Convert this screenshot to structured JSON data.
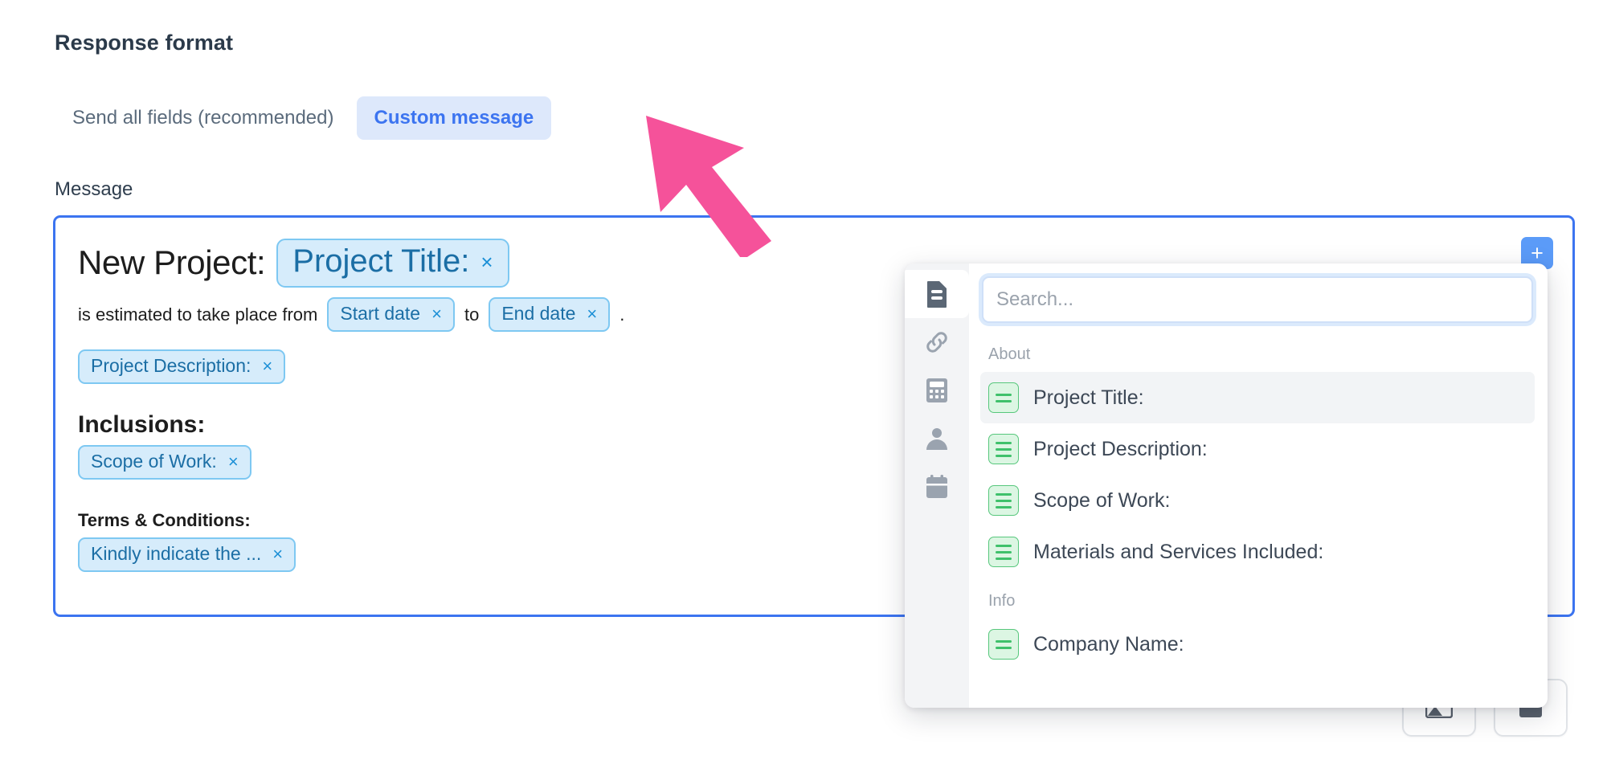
{
  "section": {
    "title": "Response format"
  },
  "format_toggle": {
    "options": [
      {
        "label": "Send all fields (recommended)",
        "active": false
      },
      {
        "label": "Custom message",
        "active": true
      }
    ]
  },
  "message_field": {
    "label": "Message",
    "content": {
      "heading_prefix": "New Project:",
      "heading_chip": "Project Title:",
      "line2_prefix": "is estimated to take place from",
      "line2_chip_start": "Start date",
      "line2_mid": "to",
      "line2_chip_end": "End date",
      "line2_suffix": ".",
      "desc_chip": "Project Description:",
      "inclusions_heading": "Inclusions:",
      "inclusions_chip": "Scope of Work:",
      "terms_heading": "Terms & Conditions:",
      "terms_chip": "Kindly indicate the ..."
    },
    "chip_close_glyph": "×",
    "add_button_glyph": "+"
  },
  "field_picker": {
    "search": {
      "value": "",
      "placeholder": "Search..."
    },
    "rail": [
      {
        "icon": "document-icon",
        "active": true
      },
      {
        "icon": "link-icon",
        "active": false
      },
      {
        "icon": "calculator-icon",
        "active": false
      },
      {
        "icon": "person-icon",
        "active": false
      },
      {
        "icon": "calendar-icon",
        "active": false
      }
    ],
    "groups": [
      {
        "label": "About",
        "options": [
          {
            "label": "Project Title:",
            "highlighted": true
          },
          {
            "label": "Project Description:",
            "highlighted": false
          },
          {
            "label": "Scope of Work:",
            "highlighted": false
          },
          {
            "label": "Materials and Services Included:",
            "highlighted": false
          }
        ]
      },
      {
        "label": "Info",
        "options": [
          {
            "label": "Company Name:",
            "highlighted": false
          }
        ]
      }
    ]
  },
  "footer_buttons": [
    {
      "name": "image-button"
    },
    {
      "name": "table-button"
    }
  ],
  "annotation": {
    "type": "arrow",
    "color": "#f5529a",
    "points_to": "Custom message"
  },
  "colors": {
    "accent_blue": "#3c74f0",
    "toggle_active_bg": "#dde8fb",
    "chip_bg": "#d6ecfb",
    "chip_border": "#7ec8f2",
    "chip_text": "#1b6ea5",
    "field_icon_green": "#3fc16b",
    "arrow_pink": "#f5529a",
    "editor_border": "#3c74f0"
  }
}
